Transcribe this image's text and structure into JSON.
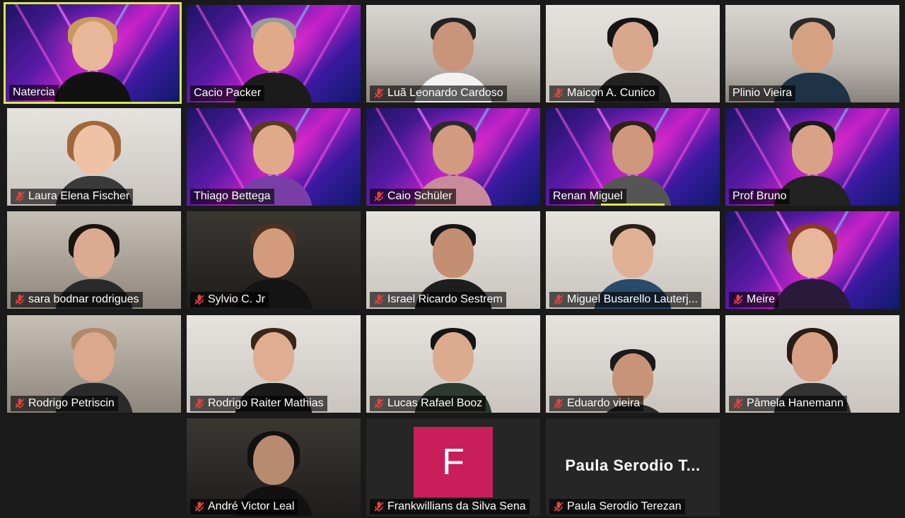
{
  "participants": [
    {
      "name": "Natercia",
      "muted": false,
      "active": true
    },
    {
      "name": "Cacio Packer",
      "muted": false
    },
    {
      "name": "Luã Leonardo Cardoso",
      "muted": true
    },
    {
      "name": "Maicon A. Cunico",
      "muted": true
    },
    {
      "name": "Plinio Vieira",
      "muted": false
    },
    {
      "name": "Laura Elena Fischer",
      "muted": true
    },
    {
      "name": "Thiago Bettega",
      "muted": false
    },
    {
      "name": "Caio Schüler",
      "muted": true
    },
    {
      "name": "Renan Miguel",
      "muted": false,
      "speaking": true
    },
    {
      "name": "Prof Bruno",
      "muted": false
    },
    {
      "name": "sara bodnar rodrigues",
      "muted": true
    },
    {
      "name": "Sylvio C. Jr",
      "muted": true
    },
    {
      "name": "Israel Ricardo Sestrem",
      "muted": true
    },
    {
      "name": "Miguel Busarello Lauterj...",
      "muted": true
    },
    {
      "name": "Meire",
      "muted": true
    },
    {
      "name": "Rodrigo Petriscin",
      "muted": true
    },
    {
      "name": "Rodrigo Raiter Mathias",
      "muted": true
    },
    {
      "name": "Lucas Rafael Booz",
      "muted": true
    },
    {
      "name": "Eduardo vieira",
      "muted": true
    },
    {
      "name": "Pâmela Hanemann",
      "muted": true
    },
    {
      "name": "André Victor Leal",
      "muted": true
    },
    {
      "name": "Frankwillians da Silva Sena",
      "muted": true,
      "avatar_initial": "F",
      "avatar_color": "#c81e5a"
    },
    {
      "name": "Paula Serodio Terezan",
      "muted": true,
      "display_big": "Paula Serodio T..."
    }
  ],
  "colors": {
    "active_border": "#d8e84c",
    "muted_icon": "#e0443e",
    "label_bg": "rgba(0,0,0,0.62)"
  }
}
